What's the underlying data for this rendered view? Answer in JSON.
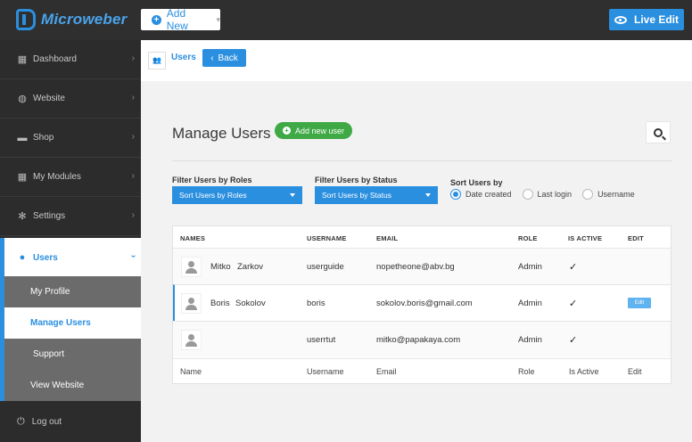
{
  "app": {
    "brand": "Microweber"
  },
  "topbar": {
    "add_new": "Add New",
    "live_edit": "Live Edit"
  },
  "sidebar": {
    "items": [
      {
        "label": "Dashboard",
        "icon": "dashboard-icon"
      },
      {
        "label": "Website",
        "icon": "globe-icon"
      },
      {
        "label": "Shop",
        "icon": "shop-icon"
      },
      {
        "label": "My Modules",
        "icon": "modules-icon"
      },
      {
        "label": "Settings",
        "icon": "gear-icon"
      },
      {
        "label": "Users",
        "icon": "user-icon"
      }
    ],
    "sub_items": [
      {
        "label": "My Profile"
      },
      {
        "label": "Manage Users"
      },
      {
        "label": "Support"
      },
      {
        "label": "View Website"
      }
    ],
    "logout": "Log out"
  },
  "breadcrumb": {
    "current": "Users",
    "back": "Back"
  },
  "main": {
    "title": "Manage Users",
    "add_user": "Add new user",
    "filter_roles_label": "Filter Users by Roles",
    "filter_roles_value": "Sort Users by Roles",
    "filter_status_label": "Filter Users by Status",
    "filter_status_value": "Sort Users by Status",
    "sort_label": "Sort Users by",
    "sort_options": [
      "Date created",
      "Last login",
      "Username"
    ],
    "sort_selected": "Date created"
  },
  "table": {
    "headers": [
      "NAMES",
      "USERNAME",
      "EMAIL",
      "ROLE",
      "IS ACTIVE",
      "EDIT"
    ],
    "rows": [
      {
        "first": "Mitko",
        "last": "Zarkov",
        "username": "userguide",
        "email": "nopetheone@abv.bg",
        "role": "Admin",
        "active": "✓",
        "edit": ""
      },
      {
        "first": "Boris",
        "last": "Sokolov",
        "username": "boris",
        "email": "sokolov.boris@gmail.com",
        "role": "Admin",
        "active": "✓",
        "edit": "Edit"
      },
      {
        "first": "",
        "last": "",
        "username": "userrtut",
        "email": "mitko@papakaya.com",
        "role": "Admin",
        "active": "✓",
        "edit": ""
      }
    ],
    "footer": [
      "Name",
      "Username",
      "Email",
      "Role",
      "Is Active",
      "Edit"
    ]
  }
}
